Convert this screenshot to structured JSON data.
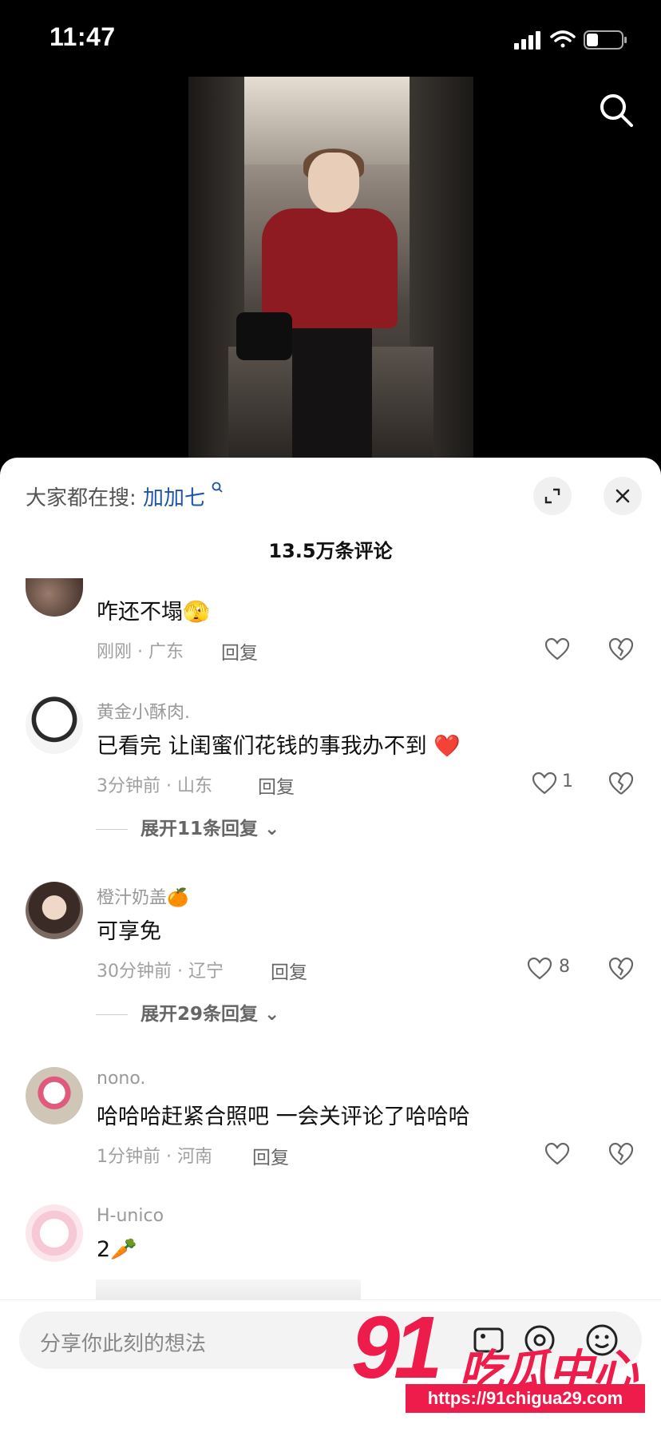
{
  "status_bar": {
    "time": "11:47"
  },
  "header": {
    "search_icon": "search-icon"
  },
  "sheet": {
    "hot_search_prefix": "大家都在搜:",
    "hot_search_keyword": "加加七",
    "comment_count": "13.5万条评论",
    "expand_icon": "expand-icon",
    "close_icon": "close-icon"
  },
  "comments": [
    {
      "username": "",
      "text": "咋还不塌",
      "emoji": "🫣",
      "meta": "刚刚 · 广东",
      "reply": "回复",
      "likes": ""
    },
    {
      "username": "黄金小酥肉.",
      "text": "已看完 让闺蜜们花钱的事我办不到",
      "emoji": "❤️",
      "meta": "3分钟前 · 山东",
      "reply": "回复",
      "likes": "1",
      "expand": "展开11条回复"
    },
    {
      "username": "橙汁奶盖",
      "username_emoji": "🍊",
      "text": "可享免",
      "meta": "30分钟前 · 辽宁",
      "reply": "回复",
      "likes": "8",
      "expand": "展开29条回复"
    },
    {
      "username": "nono.",
      "text": "哈哈哈赶紧合照吧 一会关评论了哈哈哈",
      "meta": "1分钟前 · 河南",
      "reply": "回复",
      "likes": ""
    },
    {
      "username": "H-unico",
      "text": "2",
      "emoji": "🥕"
    }
  ],
  "bottom_bar": {
    "placeholder": "分享你此刻的想法"
  },
  "watermark": {
    "number": "91",
    "brand": "吃瓜中心",
    "url": "https://91chigua29.com"
  },
  "colors": {
    "link": "#1e55a8",
    "watermark": "#ee1c4b",
    "heart_red": "#f0334f"
  }
}
